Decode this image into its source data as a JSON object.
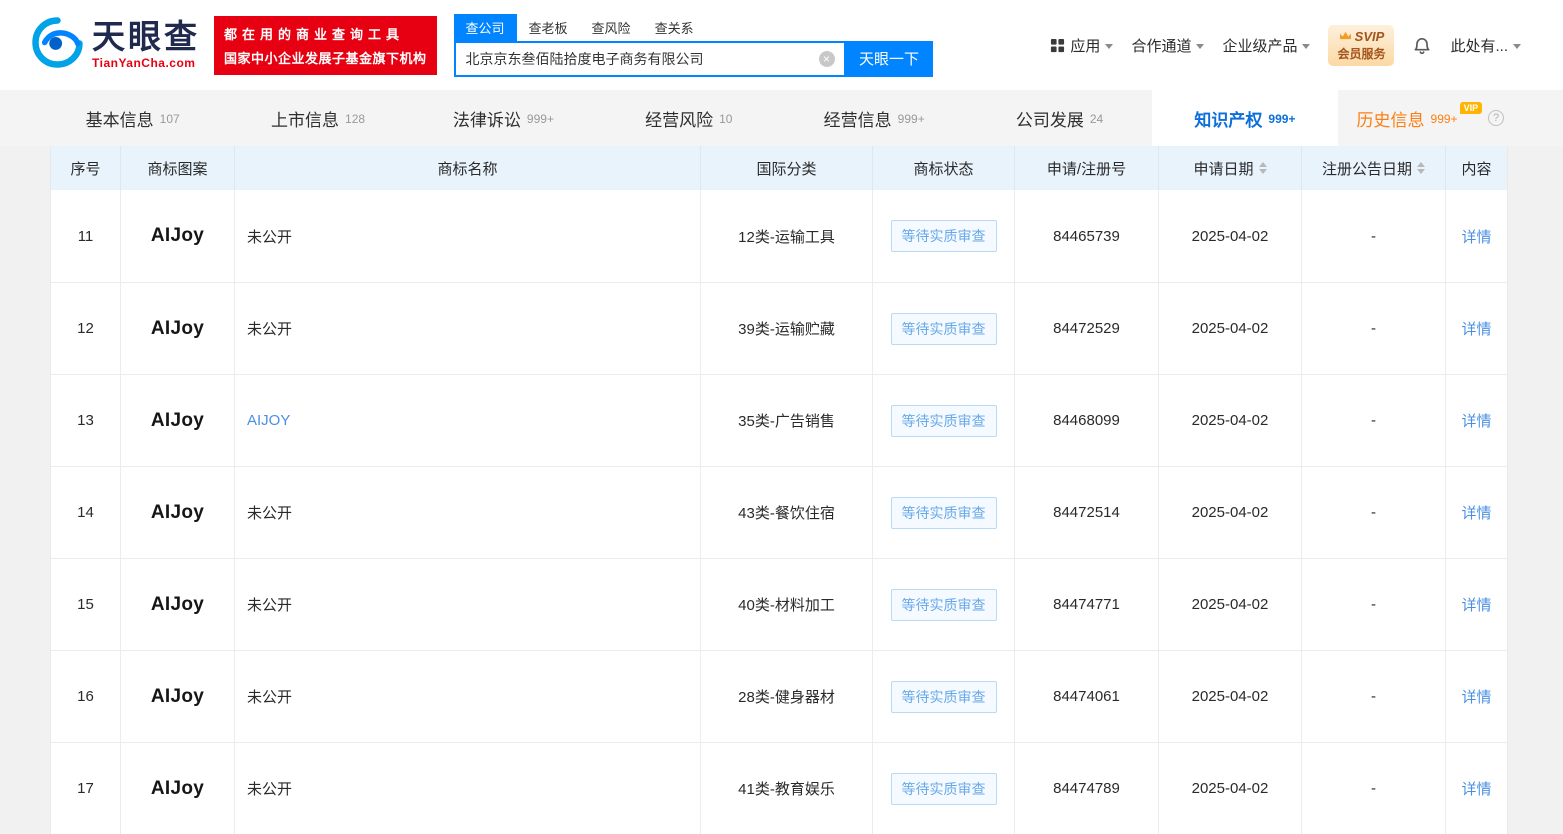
{
  "colors": {
    "brand_blue": "#0084ff",
    "brand_red": "#e60012",
    "active_tab_blue": "#0d6fd8",
    "link_blue": "#4a90e2",
    "status_blue": "#6aa9e9",
    "status_border": "#b9d9f4",
    "status_bg": "#f4faff",
    "vip_orange": "#ff7e12",
    "vip_gold": "#ffb400",
    "table_header_bg": "#e8f3fc"
  },
  "icons": {
    "clear_search": "×",
    "help": "?"
  },
  "header": {
    "logo": {
      "brand": "天眼查",
      "domain": "TianYanCha.com"
    },
    "promo": {
      "line1": "都在用的商业查询工具",
      "line2": "国家中小企业发展子基金旗下机构"
    },
    "search_tabs": [
      {
        "id": "company",
        "label": "查公司",
        "active": true
      },
      {
        "id": "boss",
        "label": "查老板",
        "active": false
      },
      {
        "id": "risk",
        "label": "查风险",
        "active": false
      },
      {
        "id": "relation",
        "label": "查关系",
        "active": false
      }
    ],
    "search": {
      "value": "北京京东叁佰陆拾度电子商务有限公司",
      "button_label": "天眼一下"
    },
    "nav": {
      "apps": "应用",
      "cooperation": "合作通道",
      "enterprise": "企业级产品",
      "svip_line1": "SVIP",
      "svip_line2": "会员服务",
      "more": "此处有..."
    }
  },
  "tabs": [
    {
      "id": "basic-info",
      "label": "基本信息",
      "count": "107"
    },
    {
      "id": "listing-info",
      "label": "上市信息",
      "count": "128"
    },
    {
      "id": "lawsuits",
      "label": "法律诉讼",
      "count": "999+"
    },
    {
      "id": "operating-risk",
      "label": "经营风险",
      "count": "10"
    },
    {
      "id": "operating-info",
      "label": "经营信息",
      "count": "999+"
    },
    {
      "id": "company-development",
      "label": "公司发展",
      "count": "24"
    },
    {
      "id": "intellectual-property",
      "label": "知识产权",
      "count": "999+",
      "active": true
    },
    {
      "id": "history-info",
      "label": "历史信息",
      "count": "999+",
      "vip": true,
      "badge": "VIP",
      "help": true
    }
  ],
  "table": {
    "headers": [
      {
        "id": "no",
        "label": "序号"
      },
      {
        "id": "image",
        "label": "商标图案"
      },
      {
        "id": "name",
        "label": "商标名称"
      },
      {
        "id": "class",
        "label": "国际分类"
      },
      {
        "id": "status",
        "label": "商标状态"
      },
      {
        "id": "app-no",
        "label": "申请/注册号"
      },
      {
        "id": "apply-date",
        "label": "申请日期",
        "sortable": true
      },
      {
        "id": "announce-date",
        "label": "注册公告日期",
        "sortable": true
      },
      {
        "id": "content",
        "label": "内容"
      }
    ],
    "rows": [
      {
        "no": "11",
        "image_text": "AIJoy",
        "name": "未公开",
        "name_is_link": false,
        "intl_class": "12类-运输工具",
        "status": "等待实质审查",
        "app_no": "84465739",
        "apply_date": "2025-04-02",
        "announce_date": "-",
        "action": "详情"
      },
      {
        "no": "12",
        "image_text": "AIJoy",
        "name": "未公开",
        "name_is_link": false,
        "intl_class": "39类-运输贮藏",
        "status": "等待实质审查",
        "app_no": "84472529",
        "apply_date": "2025-04-02",
        "announce_date": "-",
        "action": "详情"
      },
      {
        "no": "13",
        "image_text": "AIJoy",
        "name": "AIJOY",
        "name_is_link": true,
        "intl_class": "35类-广告销售",
        "status": "等待实质审查",
        "app_no": "84468099",
        "apply_date": "2025-04-02",
        "announce_date": "-",
        "action": "详情"
      },
      {
        "no": "14",
        "image_text": "AIJoy",
        "name": "未公开",
        "name_is_link": false,
        "intl_class": "43类-餐饮住宿",
        "status": "等待实质审查",
        "app_no": "84472514",
        "apply_date": "2025-04-02",
        "announce_date": "-",
        "action": "详情"
      },
      {
        "no": "15",
        "image_text": "AIJoy",
        "name": "未公开",
        "name_is_link": false,
        "intl_class": "40类-材料加工",
        "status": "等待实质审查",
        "app_no": "84474771",
        "apply_date": "2025-04-02",
        "announce_date": "-",
        "action": "详情"
      },
      {
        "no": "16",
        "image_text": "AIJoy",
        "name": "未公开",
        "name_is_link": false,
        "intl_class": "28类-健身器材",
        "status": "等待实质审查",
        "app_no": "84474061",
        "apply_date": "2025-04-02",
        "announce_date": "-",
        "action": "详情"
      },
      {
        "no": "17",
        "image_text": "AIJoy",
        "name": "未公开",
        "name_is_link": false,
        "intl_class": "41类-教育娱乐",
        "status": "等待实质审查",
        "app_no": "84474789",
        "apply_date": "2025-04-02",
        "announce_date": "-",
        "action": "详情"
      }
    ]
  }
}
